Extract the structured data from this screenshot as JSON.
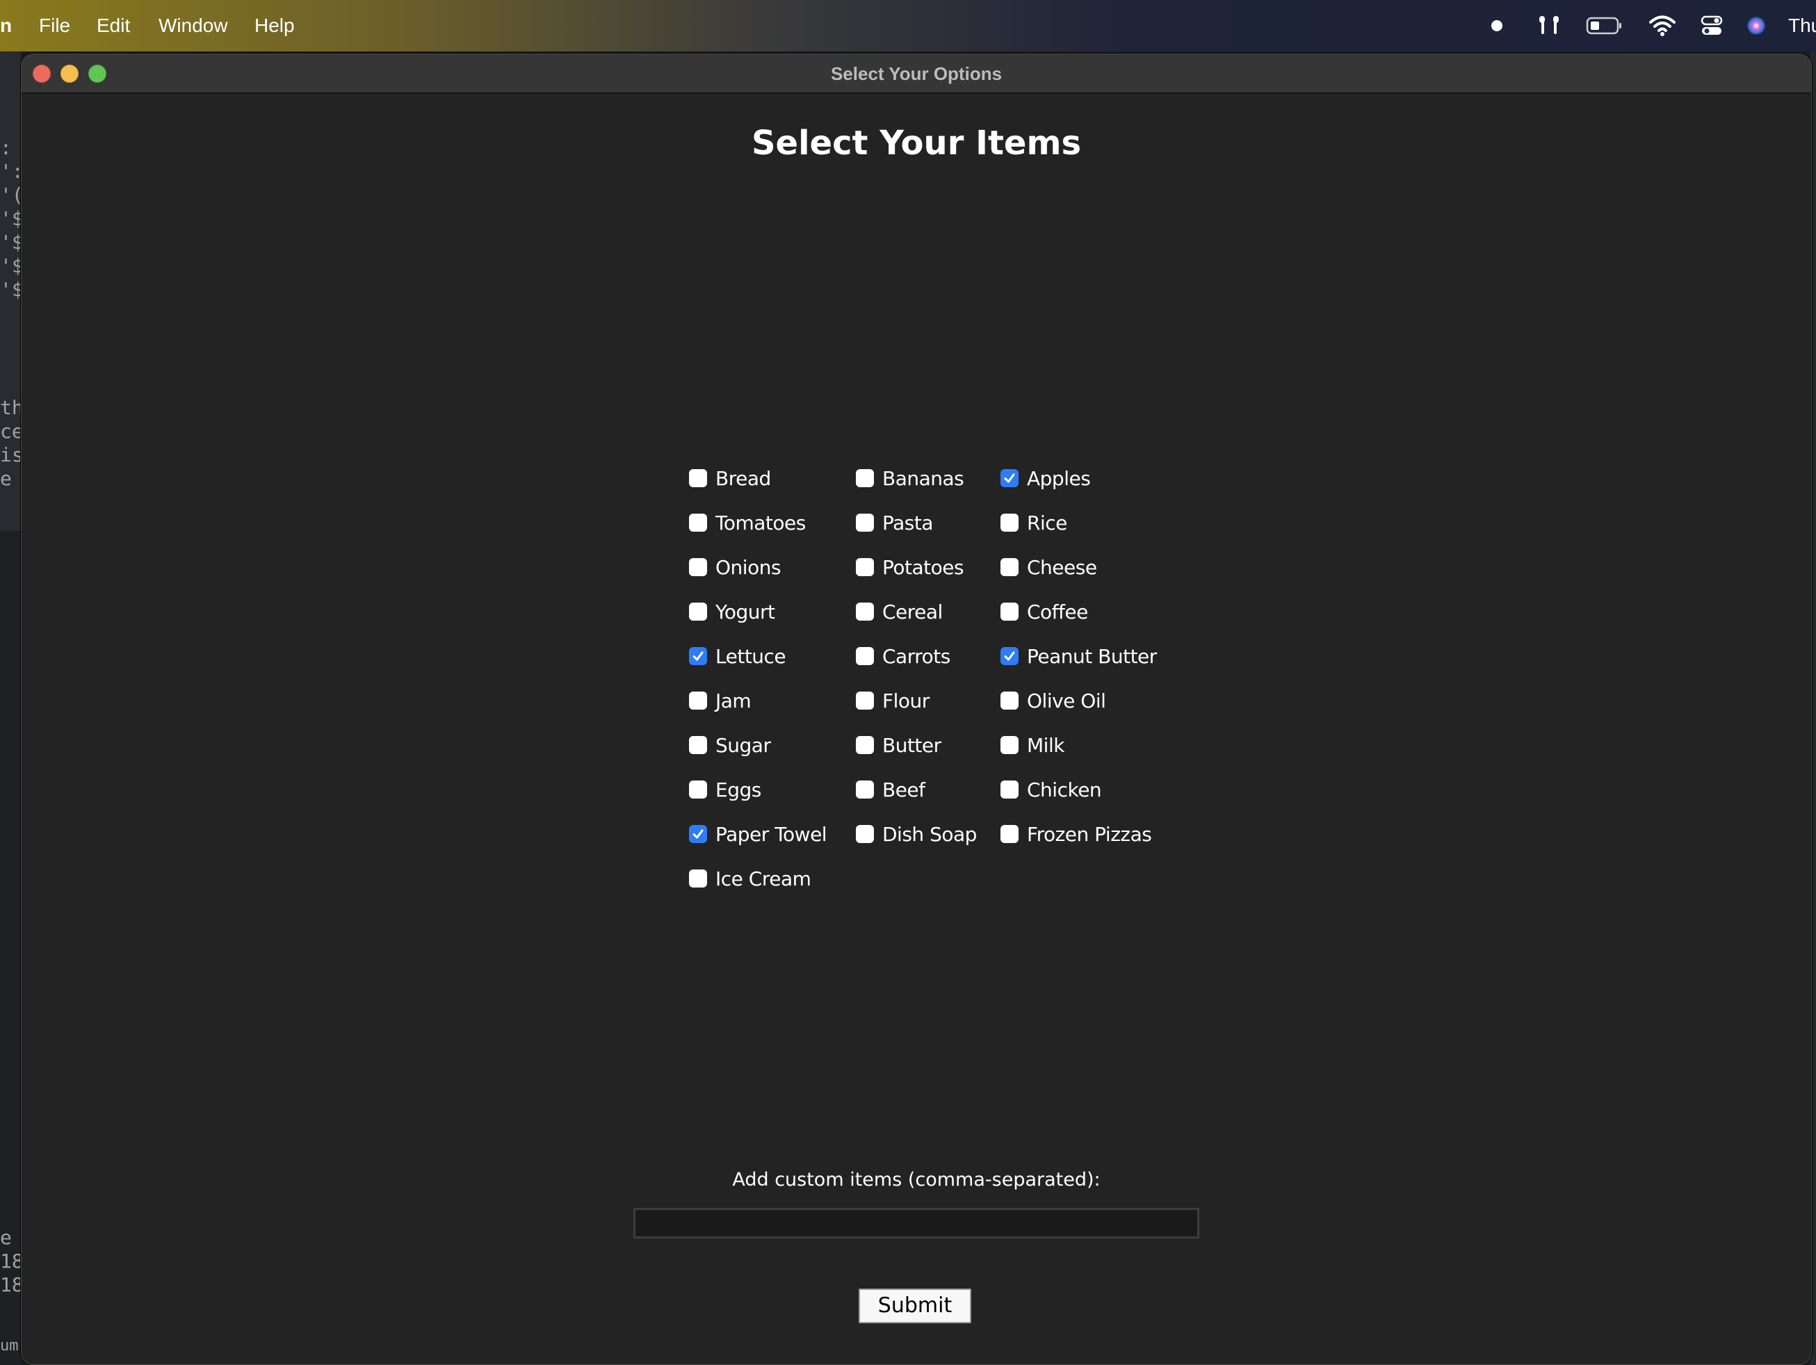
{
  "menubar": {
    "app_fragment": "n",
    "items": [
      "File",
      "Edit",
      "Window",
      "Help"
    ],
    "clock_fragment": "Thu"
  },
  "background": {
    "upper_lines": [
      ":",
      "':",
      "'(",
      "'$",
      "'$",
      "'$",
      "'$",
      "",
      "",
      "",
      "th",
      "ce",
      "is",
      "e"
    ],
    "lower_lines": [
      "e",
      "18",
      "18",
      "",
      "um"
    ]
  },
  "window": {
    "title": "Select Your Options"
  },
  "page": {
    "heading": "Select Your Items"
  },
  "checkbox_columns": [
    [
      {
        "label": "Bread",
        "checked": false
      },
      {
        "label": "Tomatoes",
        "checked": false
      },
      {
        "label": "Onions",
        "checked": false
      },
      {
        "label": "Yogurt",
        "checked": false
      },
      {
        "label": "Lettuce",
        "checked": true
      },
      {
        "label": "Jam",
        "checked": false
      },
      {
        "label": "Sugar",
        "checked": false
      },
      {
        "label": "Eggs",
        "checked": false
      },
      {
        "label": "Paper Towel",
        "checked": true
      },
      {
        "label": "Ice Cream",
        "checked": false
      }
    ],
    [
      {
        "label": "Bananas",
        "checked": false
      },
      {
        "label": "Pasta",
        "checked": false
      },
      {
        "label": "Potatoes",
        "checked": false
      },
      {
        "label": "Cereal",
        "checked": false
      },
      {
        "label": "Carrots",
        "checked": false
      },
      {
        "label": "Flour",
        "checked": false
      },
      {
        "label": "Butter",
        "checked": false
      },
      {
        "label": "Beef",
        "checked": false
      },
      {
        "label": "Dish Soap",
        "checked": false
      }
    ],
    [
      {
        "label": "Apples",
        "checked": true
      },
      {
        "label": "Rice",
        "checked": false
      },
      {
        "label": "Cheese",
        "checked": false
      },
      {
        "label": "Coffee",
        "checked": false
      },
      {
        "label": "Peanut Butter",
        "checked": true
      },
      {
        "label": "Olive Oil",
        "checked": false
      },
      {
        "label": "Milk",
        "checked": false
      },
      {
        "label": "Chicken",
        "checked": false
      },
      {
        "label": "Frozen Pizzas",
        "checked": false
      }
    ]
  ],
  "custom": {
    "label": "Add custom items (comma-separated):",
    "value": ""
  },
  "submit": {
    "label": "Submit"
  },
  "colors": {
    "checked": "#2f7cf6",
    "window_bg": "#232323"
  }
}
